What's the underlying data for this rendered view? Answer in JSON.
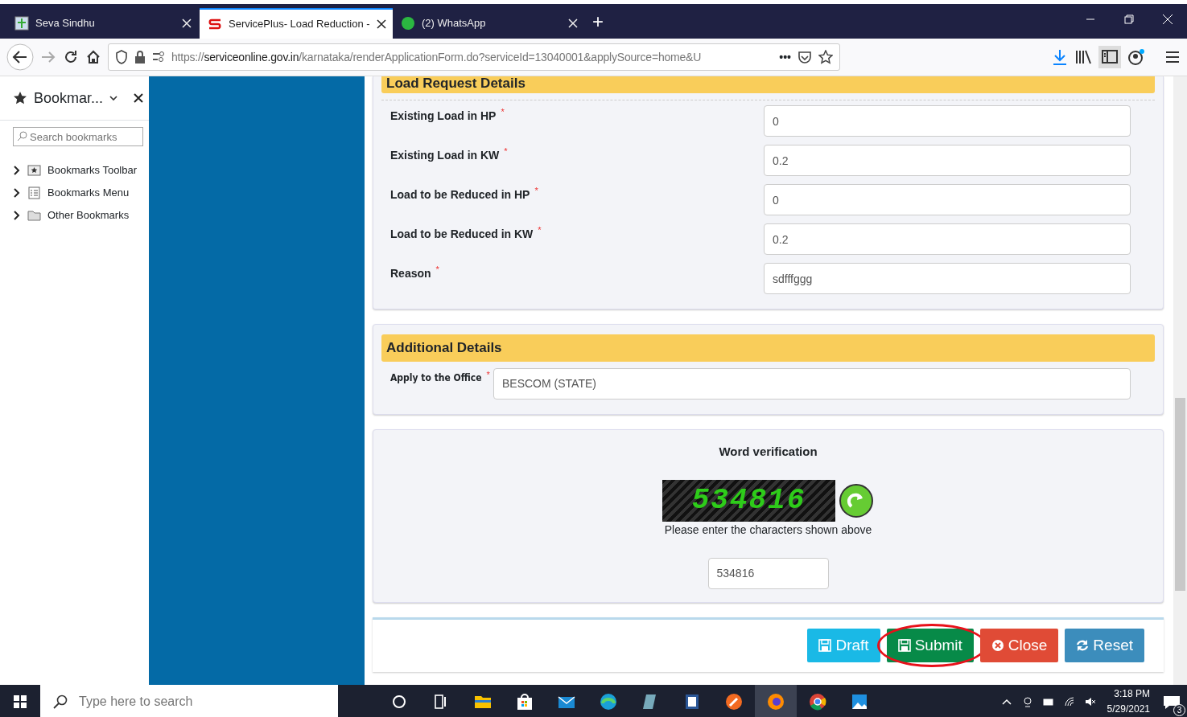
{
  "browser": {
    "tabs": [
      {
        "title": "Seva Sindhu",
        "kind": "seva",
        "selected": false
      },
      {
        "title": "ServicePlus- Load Reduction -",
        "kind": "serviceplus",
        "selected": true
      },
      {
        "title": "(2) WhatsApp",
        "kind": "whatsapp",
        "selected": false
      }
    ],
    "new_tab": "+",
    "url": {
      "scheme": "https://",
      "host": "serviceonline.gov.in",
      "path": "/karnataka/renderApplicationForm.do?serviceId=13040001&applySource=home&U"
    },
    "more": "•••"
  },
  "sidebar": {
    "title": "Bookmar...",
    "search": {
      "placeholder": "Search bookmarks"
    },
    "items": [
      {
        "label": "Bookmarks Toolbar",
        "kind": "toolbar",
        "expanded": false
      },
      {
        "label": "Bookmarks Menu",
        "kind": "menu",
        "expanded": false
      },
      {
        "label": "Other Bookmarks",
        "kind": "folder",
        "expanded": false
      }
    ]
  },
  "form": {
    "sections": [
      {
        "title": "Load Request Details",
        "fields": [
          {
            "label": "Existing Load in HP",
            "required_mark": "*",
            "value": "0"
          },
          {
            "label": "Existing Load in KW",
            "required_mark": "*",
            "value": "0.2"
          },
          {
            "label": "Load to be Reduced in HP",
            "required_mark": "*",
            "value": "0"
          },
          {
            "label": "Load to be Reduced in KW",
            "required_mark": "*",
            "value": "0.2"
          },
          {
            "label": "Reason",
            "required_mark": "*",
            "value": "sdfffggg"
          }
        ]
      },
      {
        "title": "Additional Details",
        "fields": [
          {
            "label": "Apply to the Office",
            "required_mark": "*",
            "value": "BESCOM (STATE)"
          }
        ]
      }
    ],
    "verification": {
      "title": "Word verification",
      "captcha": "534816",
      "hint": "Please enter the characters shown above",
      "value": "534816"
    },
    "buttons": [
      {
        "label": "Draft",
        "kind": "draft",
        "highlighted": false
      },
      {
        "label": "Submit",
        "kind": "submit",
        "highlighted": true
      },
      {
        "label": "Close",
        "kind": "close",
        "highlighted": false
      },
      {
        "label": "Reset",
        "kind": "reset",
        "highlighted": false
      }
    ]
  },
  "taskbar": {
    "search": {
      "placeholder": "Type here to search"
    },
    "time": "3:18 PM",
    "date": "5/29/2021",
    "notifications": "3"
  }
}
